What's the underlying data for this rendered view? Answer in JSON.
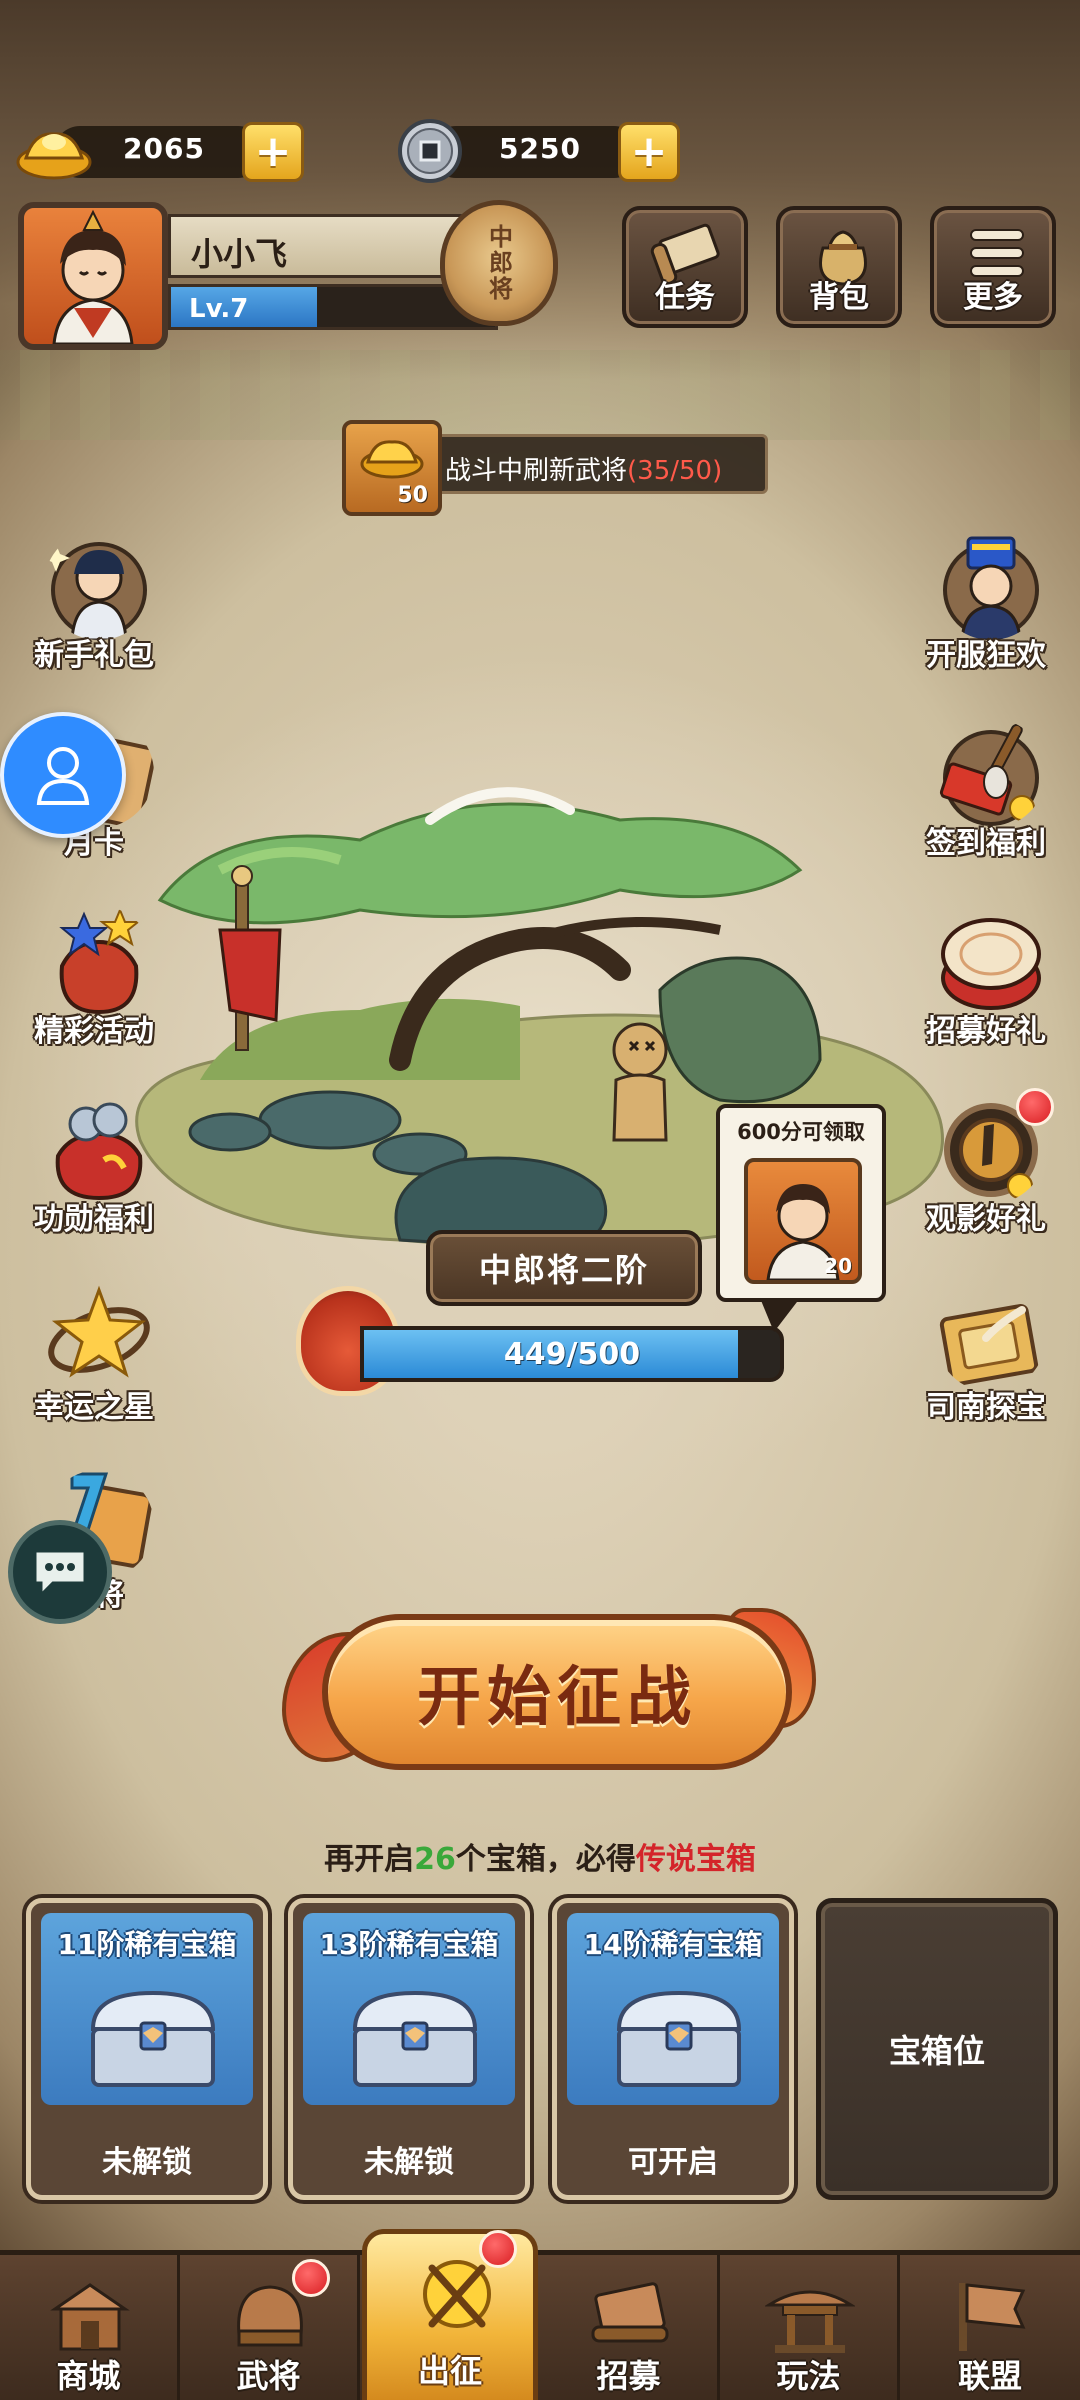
{
  "currency": {
    "gold": {
      "icon": "gold-ingot-icon",
      "value": "2065"
    },
    "coin": {
      "icon": "copper-coin-icon",
      "value": "5250"
    }
  },
  "player": {
    "name": "小小飞",
    "level": "Lv.7",
    "level_progress": 0.45,
    "rank_badge": "中郎将"
  },
  "top_buttons": [
    {
      "id": "tasks",
      "label": "任务",
      "icon": "scroll-icon"
    },
    {
      "id": "bag",
      "label": "背包",
      "icon": "pouch-icon"
    },
    {
      "id": "more",
      "label": "更多",
      "icon": "menu-icon"
    }
  ],
  "refresh_banner": {
    "badge_count": "50",
    "text": "战斗中刷新武将",
    "count": "(35/50)"
  },
  "left_icons": [
    {
      "label": "新手礼包",
      "icon": "warrior-gift-icon"
    },
    {
      "label": "月卡",
      "icon": "month-card-icon"
    },
    {
      "label": "精彩活动",
      "icon": "star-sack-icon"
    },
    {
      "label": "功勋福利",
      "icon": "honor-sack-icon"
    },
    {
      "label": "幸运之星",
      "icon": "lucky-star-icon"
    },
    {
      "label": "天将",
      "icon": "heaven-general-icon"
    }
  ],
  "right_icons": [
    {
      "label": "开服狂欢",
      "icon": "emperor-icon",
      "badge": false
    },
    {
      "label": "签到福利",
      "icon": "signin-brush-icon",
      "badge": false
    },
    {
      "label": "招募好礼",
      "icon": "drum-icon",
      "badge": false
    },
    {
      "label": "观影好礼",
      "icon": "video-gift-icon",
      "badge": true
    },
    {
      "label": "司南探宝",
      "icon": "compass-icon",
      "badge": false
    }
  ],
  "stage": {
    "name": "中郎将二阶",
    "progress_text": "449/500",
    "progress": 0.898,
    "reward_hint": "600分可领取",
    "reward_count": "20"
  },
  "start_button": {
    "label": "开始征战"
  },
  "chest_hint": {
    "prefix": "再开启",
    "count": "26",
    "middle": "个宝箱，必得",
    "highlight": "传说宝箱"
  },
  "chests": [
    {
      "title": "11阶稀有宝箱",
      "status": "未解锁"
    },
    {
      "title": "13阶稀有宝箱",
      "status": "未解锁"
    },
    {
      "title": "14阶稀有宝箱",
      "status": "可开启"
    }
  ],
  "chest_slot": {
    "label": "宝箱位"
  },
  "nav": [
    {
      "label": "商城",
      "icon": "shop-icon",
      "active": false,
      "badge": false
    },
    {
      "label": "武将",
      "icon": "helmet-icon",
      "active": false,
      "badge": true
    },
    {
      "label": "出征",
      "icon": "battle-icon",
      "active": true,
      "badge": true
    },
    {
      "label": "招募",
      "icon": "recruit-banner-icon",
      "active": false,
      "badge": false
    },
    {
      "label": "玩法",
      "icon": "pavilion-icon",
      "active": false,
      "badge": false
    },
    {
      "label": "联盟",
      "icon": "alliance-flag-icon",
      "active": false,
      "badge": false
    }
  ],
  "colors": {
    "accent_gold": "#f2b53a",
    "progress_blue": "#2b8ad6",
    "highlight_red": "#d4242a",
    "highlight_green": "#3aa83a"
  }
}
